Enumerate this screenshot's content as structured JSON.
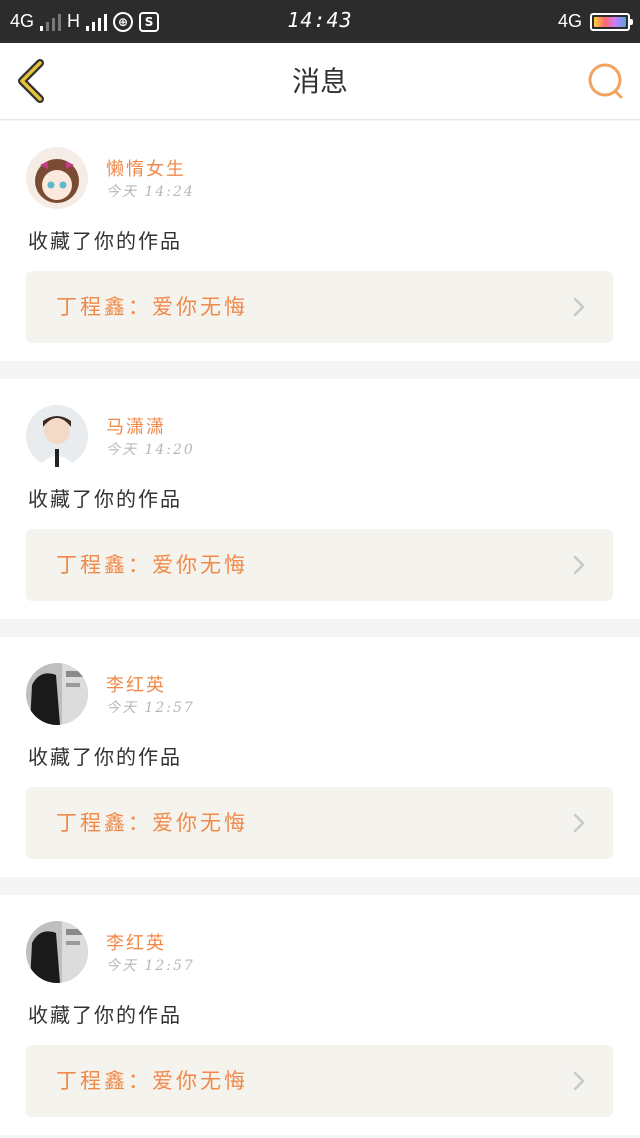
{
  "status_bar": {
    "network_1": "4G",
    "network_2": "H",
    "time": "14:43",
    "network_right": "4G",
    "icon_left_1": "globe-icon",
    "icon_left_2": "s-app-icon",
    "accent": "#2c2c2c"
  },
  "nav": {
    "title": "消息",
    "back_icon": "chevron-left-icon",
    "search_icon": "search-icon",
    "accent": "#f2a35d"
  },
  "messages": [
    {
      "user": "懒惰女生",
      "time": "今天 14:24",
      "action": "收藏了你的作品",
      "work": "丁程鑫：爱你无悔"
    },
    {
      "user": "马潇潇",
      "time": "今天 14:20",
      "action": "收藏了你的作品",
      "work": "丁程鑫：爱你无悔"
    },
    {
      "user": "李红英",
      "time": "今天 12:57",
      "action": "收藏了你的作品",
      "work": "丁程鑫：爱你无悔"
    },
    {
      "user": "李红英",
      "time": "今天 12:57",
      "action": "收藏了你的作品",
      "work": "丁程鑫：爱你无悔"
    }
  ],
  "colors": {
    "name": "#f08a4b",
    "work_bg": "#f4f3ee",
    "page_bg": "#f5f5f5"
  }
}
